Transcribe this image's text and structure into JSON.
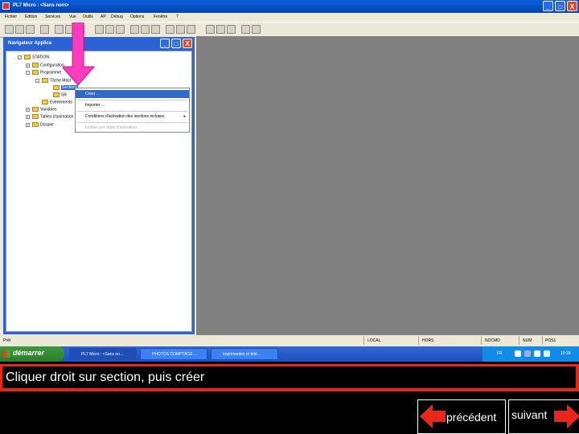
{
  "window": {
    "title": "PL7 Micro : <Sans nom>",
    "min": "_",
    "max": "□",
    "close": "X"
  },
  "menu": [
    "Fichier",
    "Edition",
    "Services",
    "Vue",
    "Outils",
    "AP",
    "Debug",
    "Options",
    "Fenêtre",
    "?"
  ],
  "navigator": {
    "title": "Navigateur Applica",
    "tree": [
      {
        "label": "STATION",
        "level": 0,
        "expander": "-"
      },
      {
        "label": "Configuration",
        "level": 1,
        "expander": "+"
      },
      {
        "label": "Programme",
        "level": 1,
        "expander": "-"
      },
      {
        "label": "Tâche Mast",
        "level": 2,
        "expander": "-"
      },
      {
        "label": "Sections",
        "level": 3,
        "expander": "",
        "selected": true
      },
      {
        "label": "SR",
        "level": 3,
        "expander": ""
      },
      {
        "label": "Evénements",
        "level": 2,
        "expander": ""
      },
      {
        "label": "Variables",
        "level": 1,
        "expander": "+"
      },
      {
        "label": "Tables d'animation",
        "level": 1,
        "expander": "+"
      },
      {
        "label": "Dossier",
        "level": 1,
        "expander": "+"
      }
    ]
  },
  "context_menu": [
    {
      "label": "Créer ...",
      "highlighted": true
    },
    {
      "label": "Importer ..."
    },
    {
      "label": "Conditions d'activation des sections incluses",
      "submenu": "▸"
    },
    {
      "label": "Inhiber une table d'animation",
      "disabled": true
    }
  ],
  "status": {
    "left": "Prêt",
    "s1": "LOCAL",
    "s2": "HORS",
    "s3": "NOCMD",
    "s4": "NUM",
    "s5": "POS1"
  },
  "taskbar": {
    "start": "démarrer",
    "tasks": [
      "PL7 Micro : <Sans no...",
      "PHOTOS COMPTAGE ...",
      "Imprimantes et télé..."
    ],
    "lang": "FR",
    "clock": "10:28"
  },
  "caption": "Cliquer droit sur section, puis créer",
  "nav_buttons": {
    "prev": "précédent",
    "next": "suivant"
  },
  "colors": {
    "arrow": "#ff3cbe",
    "caption_border": "#e8261a",
    "nav_arrow": "#e8261a",
    "selection": "#316ac5"
  }
}
